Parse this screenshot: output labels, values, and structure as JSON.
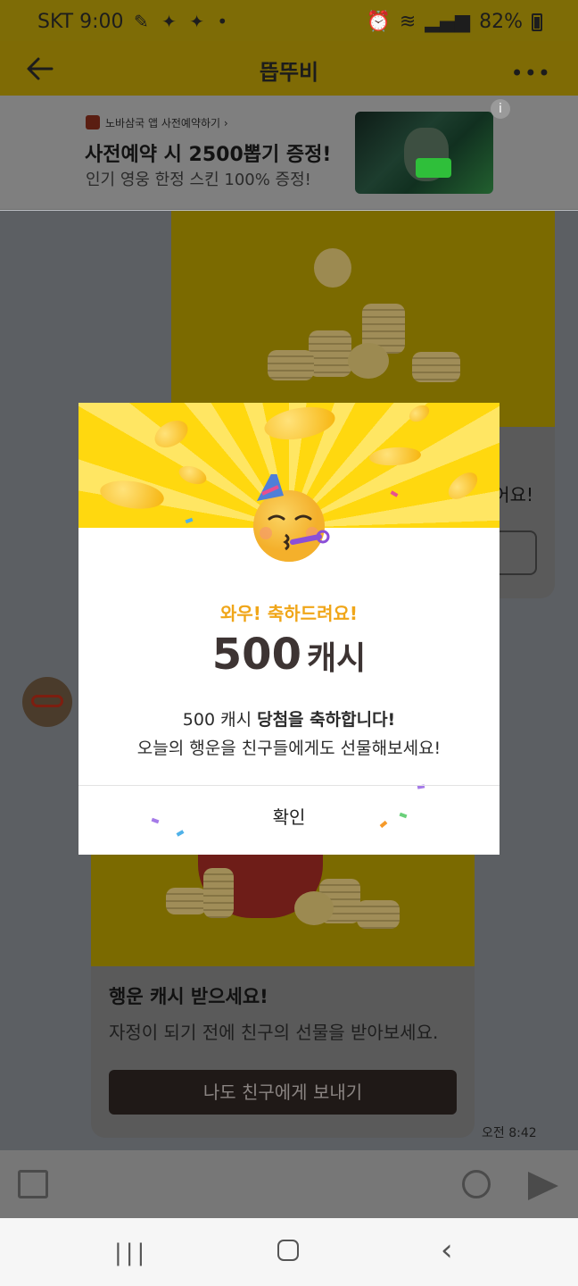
{
  "status_bar": {
    "carrier_time": "SKT 9:00",
    "battery": "82%"
  },
  "header": {
    "title": "뜹뚜비"
  },
  "ad": {
    "app_name": "노바삼국 앱 사전예약하기 ›",
    "headline": "사전예약 시 2500뽑기 증정!",
    "subtitle": "인기 영웅 한정 스킨 100% 증정!"
  },
  "chat": {
    "card1_text": "어요!",
    "card2_title": "행운 캐시 받으세요!",
    "card2_desc": "자정이 되기 전에 친구의 선물을 받아보세요.",
    "card2_button": "나도 친구에게 보내기",
    "timestamp": "오전 8:42"
  },
  "modal": {
    "subtitle": "와우! 축하드려요!",
    "amount": "500",
    "unit": "캐시",
    "message_line1_a": "500 캐시 ",
    "message_line1_b": "당첨을 축하합니다!",
    "message_line2": "오늘의 행운을 친구들에게도 선물해보세요!",
    "confirm_label": "확인"
  },
  "colors": {
    "accent_yellow": "#ffd80f",
    "subtitle_orange": "#f0a619",
    "amount_text": "#3d3433"
  }
}
